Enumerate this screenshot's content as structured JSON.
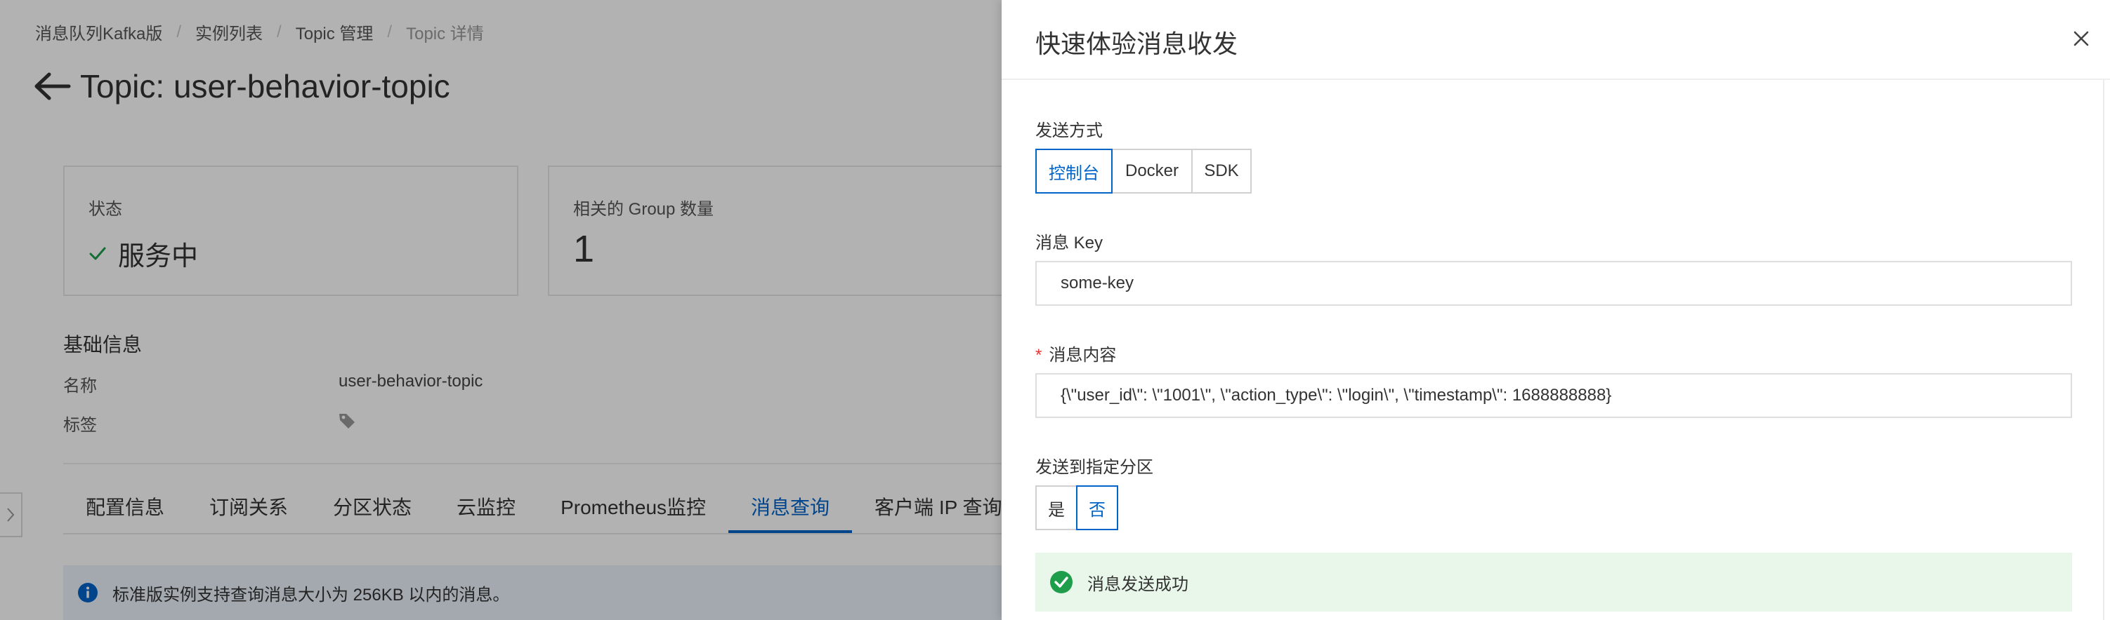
{
  "breadcrumb": [
    "消息队列Kafka版",
    "实例列表",
    "Topic 管理",
    "Topic 详情"
  ],
  "page": {
    "title": "Topic: user-behavior-topic",
    "status_card": {
      "label": "状态",
      "value": "服务中"
    },
    "group_card": {
      "label": "相关的 Group 数量",
      "value": "1"
    },
    "basic_info": {
      "title": "基础信息",
      "name_label": "名称",
      "name_value": "user-behavior-topic",
      "tag_label": "标签"
    },
    "tabs": [
      {
        "label": "配置信息",
        "active": false
      },
      {
        "label": "订阅关系",
        "active": false
      },
      {
        "label": "分区状态",
        "active": false
      },
      {
        "label": "云监控",
        "active": false
      },
      {
        "label": "Prometheus监控",
        "active": false
      },
      {
        "label": "消息查询",
        "active": true
      },
      {
        "label": "客户端 IP 查询",
        "active": false
      }
    ],
    "notice": "标准版实例支持查询消息大小为 256KB 以内的消息。"
  },
  "drawer": {
    "title": "快速体验消息收发",
    "send_method": {
      "label": "发送方式",
      "options": [
        "控制台",
        "Docker",
        "SDK"
      ],
      "selected": "控制台"
    },
    "message_key": {
      "label": "消息 Key",
      "value": "some-key"
    },
    "message_content": {
      "label": "消息内容",
      "required_mark": "*",
      "value": "{\\\"user_id\\\": \\\"1001\\\", \\\"action_type\\\": \\\"login\\\", \\\"timestamp\\\": 1688888888}"
    },
    "partition": {
      "label": "发送到指定分区",
      "options": [
        "是",
        "否"
      ],
      "selected": "否"
    },
    "success_message": "消息发送成功"
  },
  "colors": {
    "primary": "#0064c8",
    "success": "#1e9e4a",
    "success_bg": "#e8f7ea",
    "info_bg": "#eaf2fb",
    "required": "#e33333"
  }
}
